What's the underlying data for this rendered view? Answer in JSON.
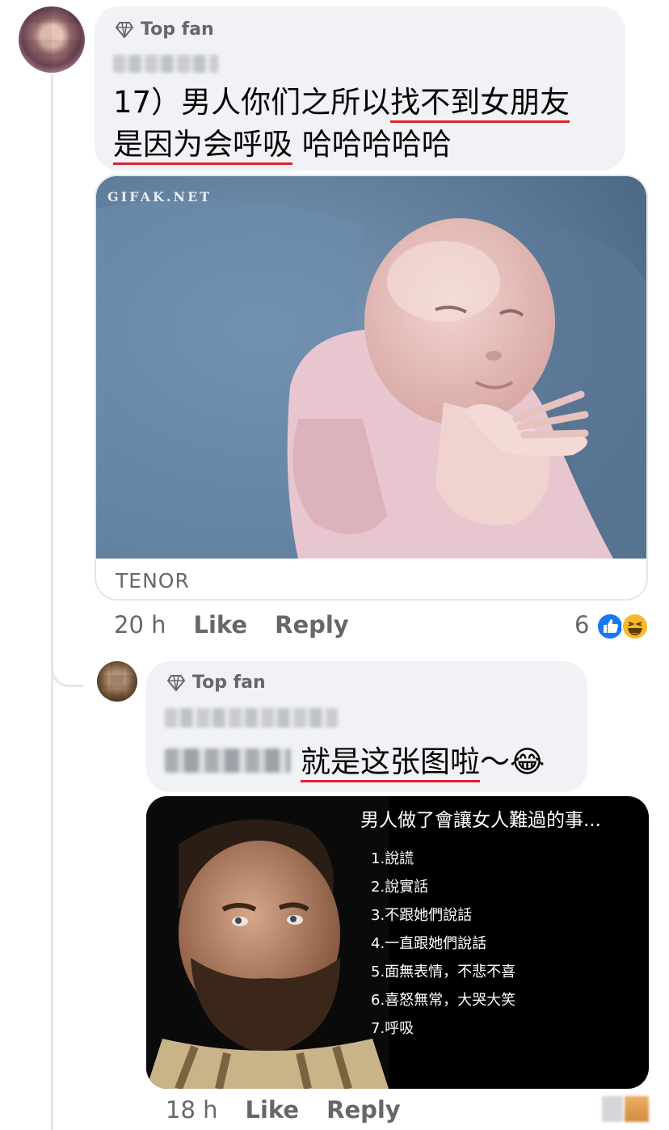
{
  "comment1": {
    "badge": "Top fan",
    "text_line1_pre": "17）男人你们之所以",
    "text_line1_ul": "找不到女朋友",
    "text_line2_ul": "是因为会呼吸",
    "text_line2_post": " 哈哈哈哈哈",
    "gif": {
      "watermark": "GIFAK.NET",
      "source": "TENOR"
    },
    "time": "20 h",
    "like": "Like",
    "reply": "Reply",
    "reaction_count": "6",
    "reactions": [
      "like-icon",
      "haha-icon"
    ]
  },
  "comment2": {
    "badge": "Top fan",
    "text_ul": "就是这张图啦",
    "text_post": "～",
    "emoji": "😂",
    "image": {
      "title": "男人做了會讓女人難過的事...",
      "items": [
        "1.說謊",
        "2.說實話",
        "3.不跟她們說話",
        "4.一直跟她們說話",
        "5.面無表情，不悲不喜",
        "6.喜怒無常，大哭大笑",
        "7.呼吸"
      ]
    },
    "time": "18 h",
    "like": "Like",
    "reply": "Reply"
  },
  "colors": {
    "bubble": "#f0f2f5",
    "meta_text": "#65676b",
    "underline": "#e0212e",
    "like_blue": "#1877f2",
    "haha_yellow": "#f7b928"
  }
}
